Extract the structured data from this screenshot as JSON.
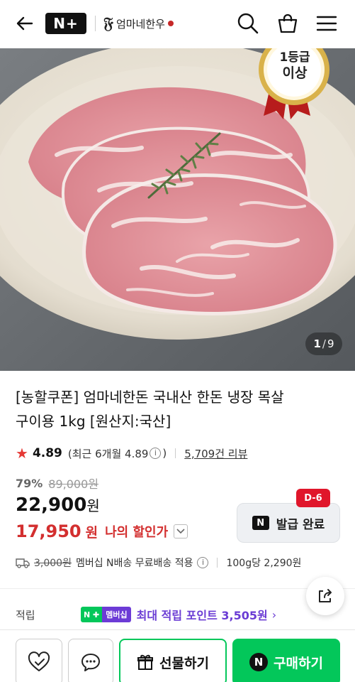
{
  "header": {
    "back_icon": "back-arrow-icon",
    "brand_badge": "N+",
    "store_logo_text": "엄마네한우",
    "search_icon": "search-icon",
    "cart_icon": "shopping-bag-icon",
    "menu_icon": "hamburger-menu-icon"
  },
  "hero": {
    "image_alt": "product-photo",
    "grade_badge_top": "1등급",
    "grade_badge_bottom": "이상",
    "counter_current": "1",
    "counter_sep": "/",
    "counter_total": "9"
  },
  "product": {
    "title_line1": "[농할쿠폰] 엄마네한돈 국내산 한돈 냉장 목살",
    "title_line2": "구이용 1kg [원산지:국산]",
    "rating_score": "4.89",
    "rating_recent": "(최근 6개월 4.89",
    "rating_recent_close": ")",
    "review_count": "5,709건 리뷰",
    "discount_pct": "79%",
    "original_price": "89,000원",
    "sale_price": "22,900",
    "sale_price_unit": "원",
    "my_price": "17,950",
    "my_price_unit": "원",
    "my_price_label": "나의 할인가",
    "coupon_badge": "D-6",
    "coupon_button_label": "발급 완료",
    "coupon_logo": "N"
  },
  "shipping": {
    "fee_original": "3,000원",
    "fee_text": "멤버십 N배송 무료배송 적용",
    "unit_price": "100g당 2,290원"
  },
  "points": {
    "label": "적립",
    "badge_n": "N ✚",
    "badge_member": "멤버십",
    "text": "최대 적립 포인트 3,505원",
    "arrow": "›"
  },
  "bottom_bar": {
    "gift_label": "선물하기",
    "buy_label": "구매하기",
    "buy_logo": "N"
  },
  "colors": {
    "naver_green": "#03c75a",
    "discount_red": "#d32f2f",
    "coupon_red": "#e0162b",
    "membership_purple": "#6a3cd4"
  }
}
